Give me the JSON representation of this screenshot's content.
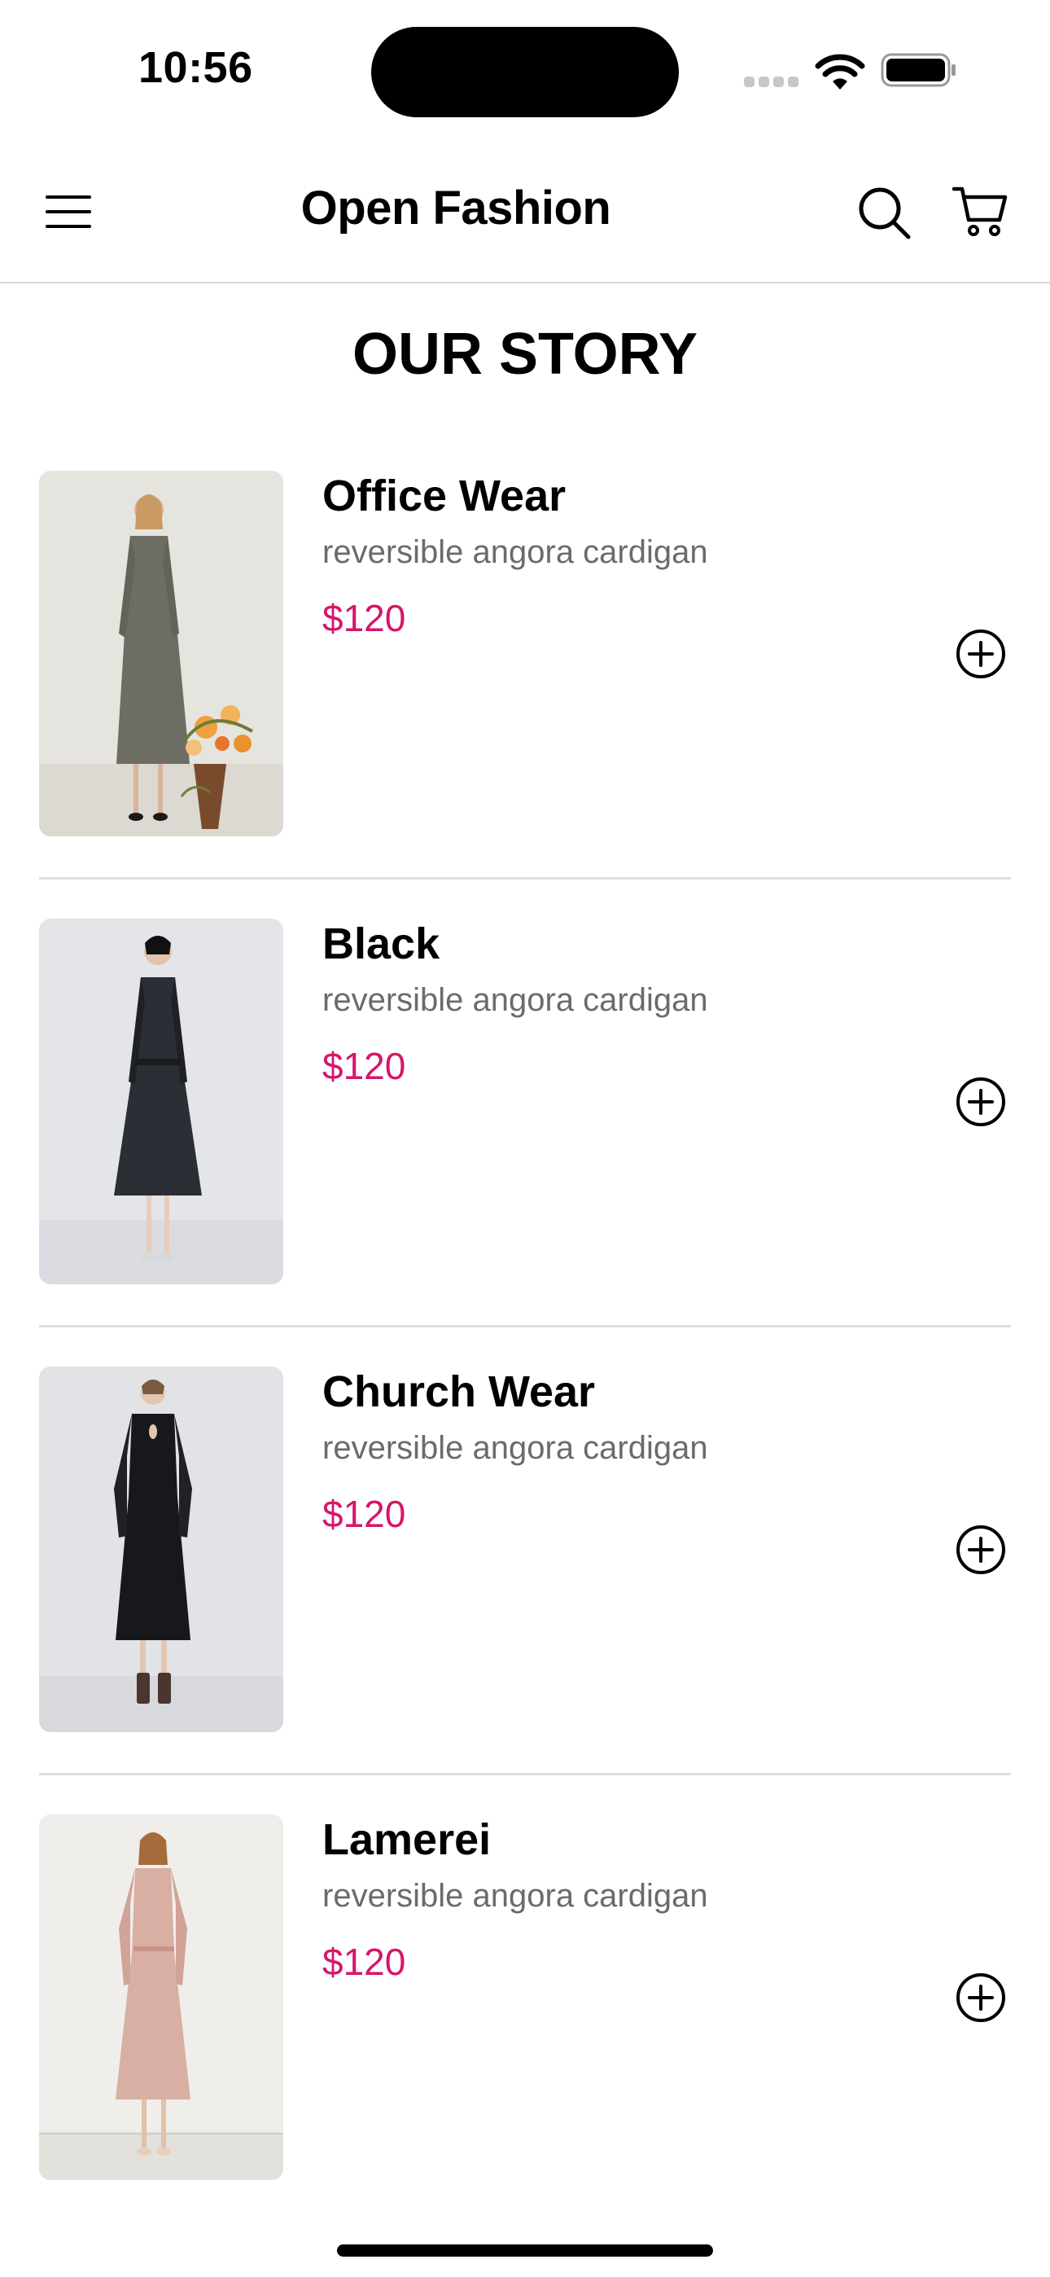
{
  "status_bar": {
    "time": "10:56"
  },
  "header": {
    "title": "Open Fashion",
    "menu_icon": "hamburger-menu-icon",
    "search_icon": "search-icon",
    "cart_icon": "cart-icon"
  },
  "section": {
    "title": "OUR STORY"
  },
  "products": [
    {
      "name": "Office Wear",
      "description": "reversible angora cardigan",
      "price": "$120",
      "image_icon": "grey-tweed-dress-photo"
    },
    {
      "name": "Black",
      "description": "reversible angora cardigan",
      "price": "$120",
      "image_icon": "black-coat-dress-photo"
    },
    {
      "name": "Church Wear",
      "description": "reversible angora cardigan",
      "price": "$120",
      "image_icon": "black-midi-dress-photo"
    },
    {
      "name": "Lamerei",
      "description": "reversible angora cardigan",
      "price": "$120",
      "image_icon": "pink-midi-dress-photo"
    }
  ],
  "colors": {
    "price": "#d6156b",
    "description": "#6b6b6b",
    "divider": "#dedede"
  }
}
